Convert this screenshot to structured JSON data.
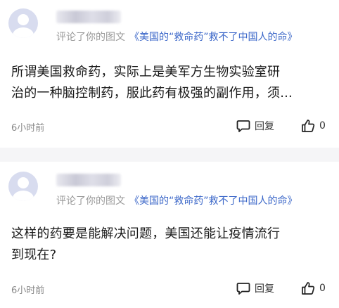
{
  "comments": [
    {
      "reply_prefix": "评论了你的图文",
      "article_title": "《美国的“救命药”救不了中国人的命》",
      "content_line1": "所谓美国救命药，实际上是美军方生物实验室研",
      "content_line2": "治的一种脑控制药，服此药有极强的副作用，须...",
      "time": "6小时前",
      "reply_label": "回复",
      "like_count": "0"
    },
    {
      "reply_prefix": "评论了你的图文",
      "article_title": "《美国的“救命药”救不了中国人的命》",
      "content_line1": "这样的药要是能解决问题，美国还能让疫情流行",
      "content_line2": "到现在?",
      "time": "6小时前",
      "reply_label": "回复",
      "like_count": "0"
    }
  ],
  "icons": {
    "avatar": "default-avatar-icon",
    "reply": "comment-bubble-icon",
    "like": "thumbs-up-icon"
  },
  "colors": {
    "link": "#3a66c8",
    "muted": "#999999",
    "divider": "#f5f5f7"
  }
}
